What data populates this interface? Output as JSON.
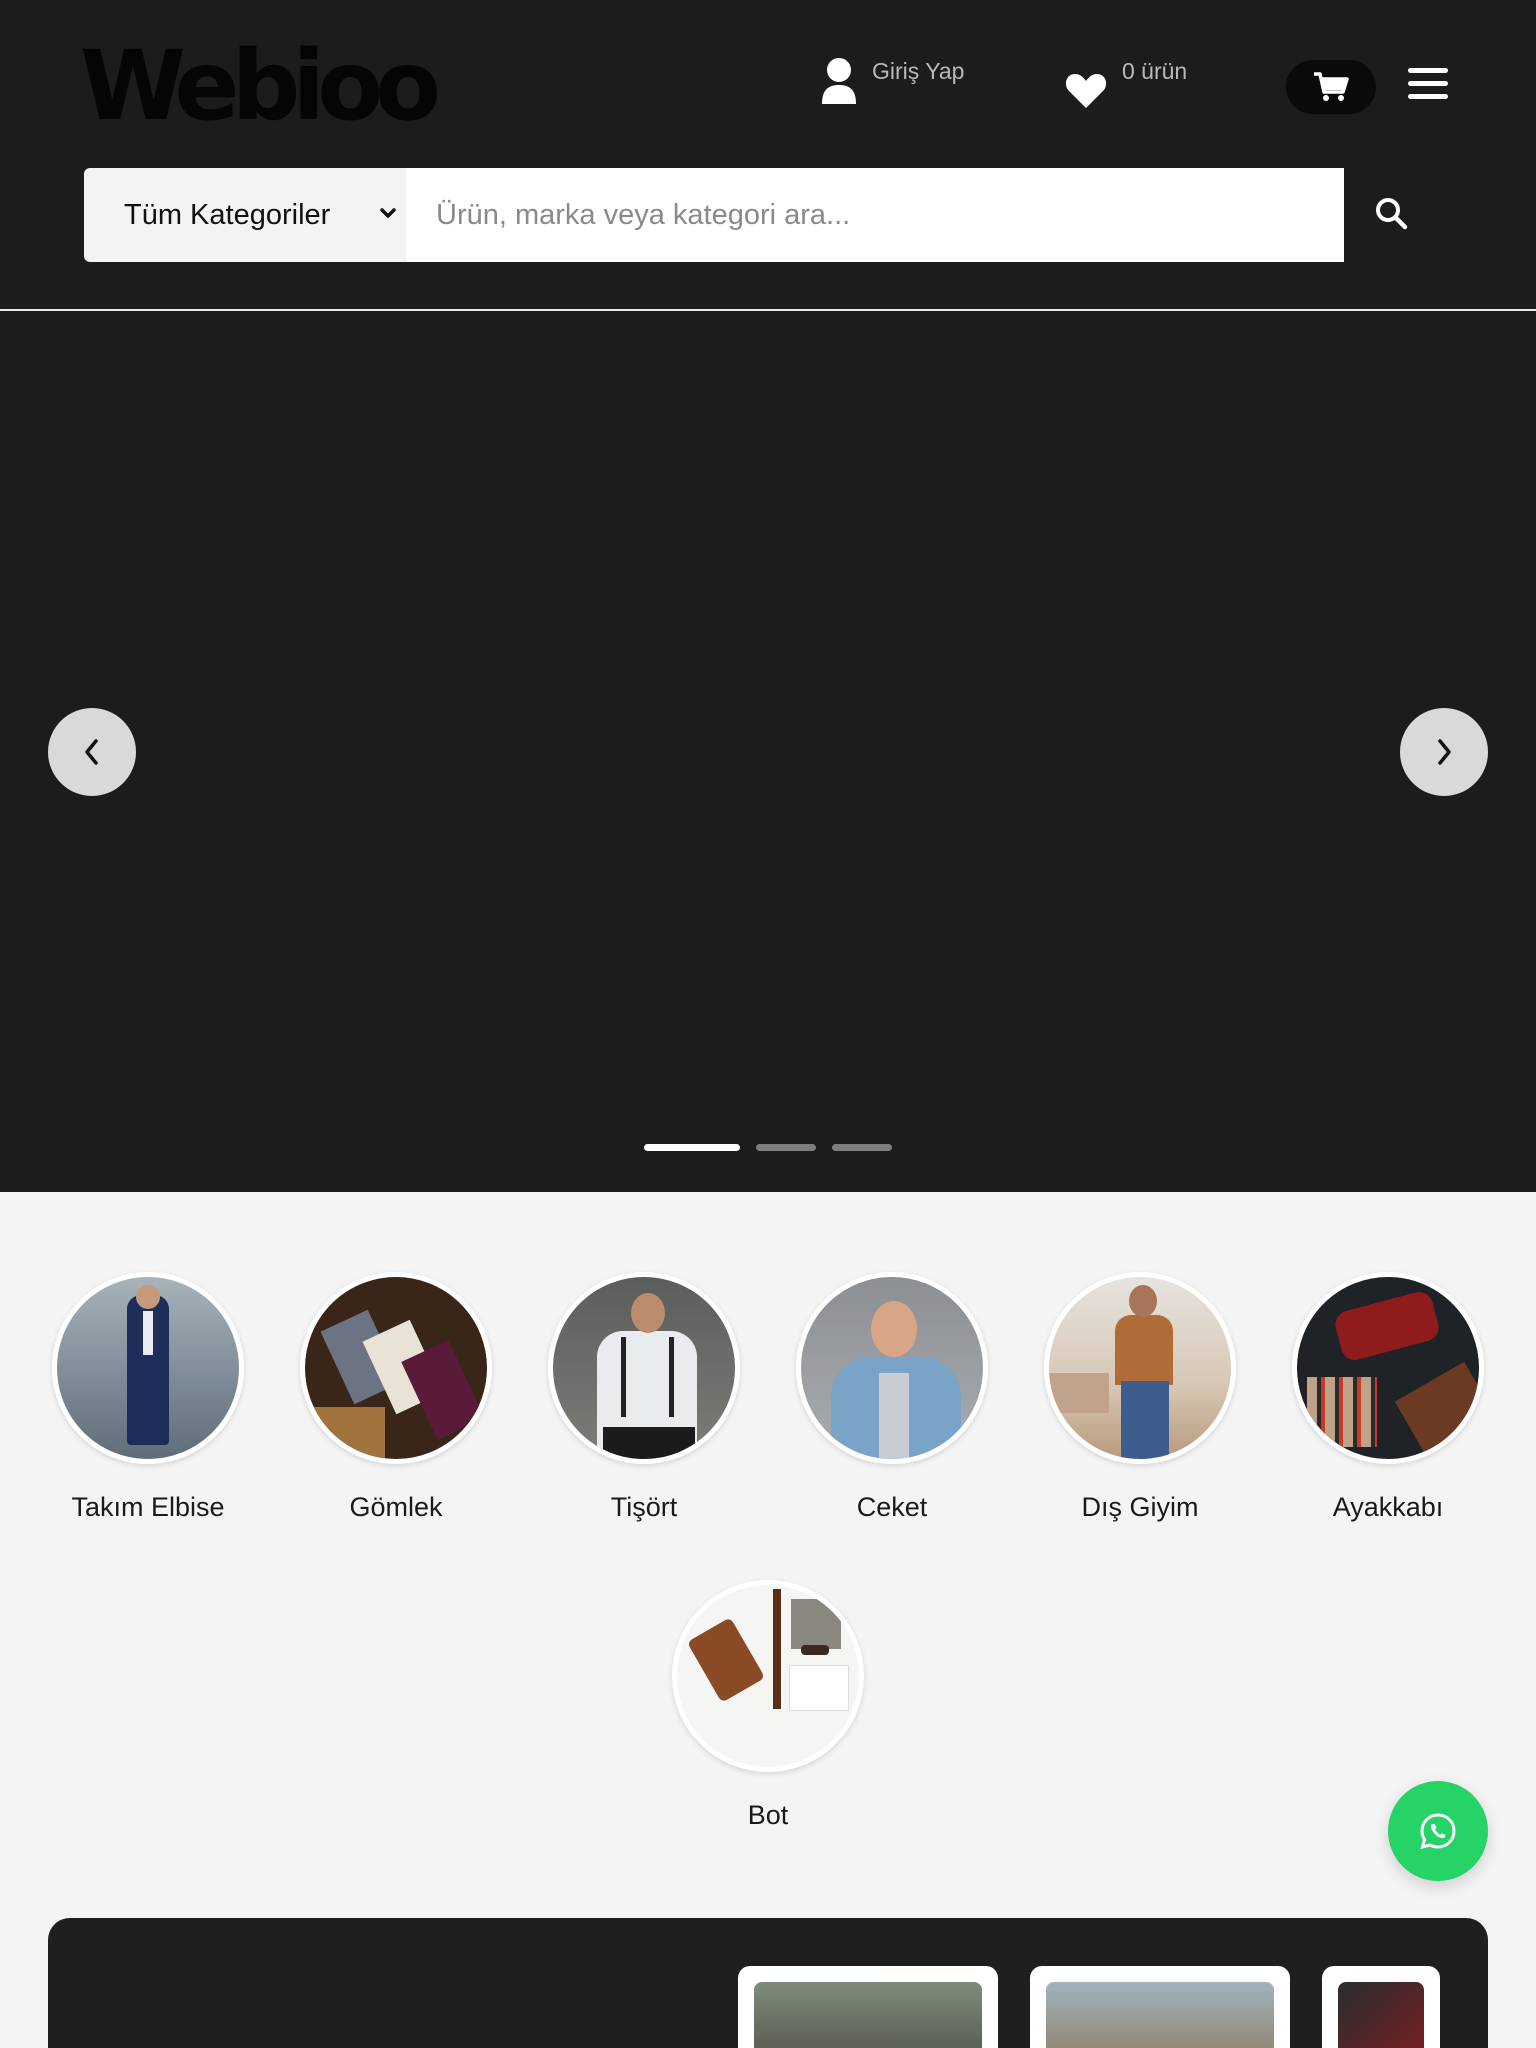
{
  "header": {
    "logo": "Webioo",
    "login_label": "Giriş Yap",
    "favorites_label": "0 ürün",
    "search": {
      "category_selected": "Tüm Kategoriler",
      "placeholder": "Ürün, marka veya kategori ara..."
    }
  },
  "hero": {
    "slide_count": 3,
    "active_slide": 1
  },
  "categories": [
    {
      "label": "Takım Elbise"
    },
    {
      "label": "Gömlek"
    },
    {
      "label": "Tişört"
    },
    {
      "label": "Ceket"
    },
    {
      "label": "Dış Giyim"
    },
    {
      "label": "Ayakkabı"
    },
    {
      "label": "Bot"
    }
  ],
  "colors": {
    "header_bg": "#1c1c1d",
    "whatsapp": "#25d366"
  }
}
